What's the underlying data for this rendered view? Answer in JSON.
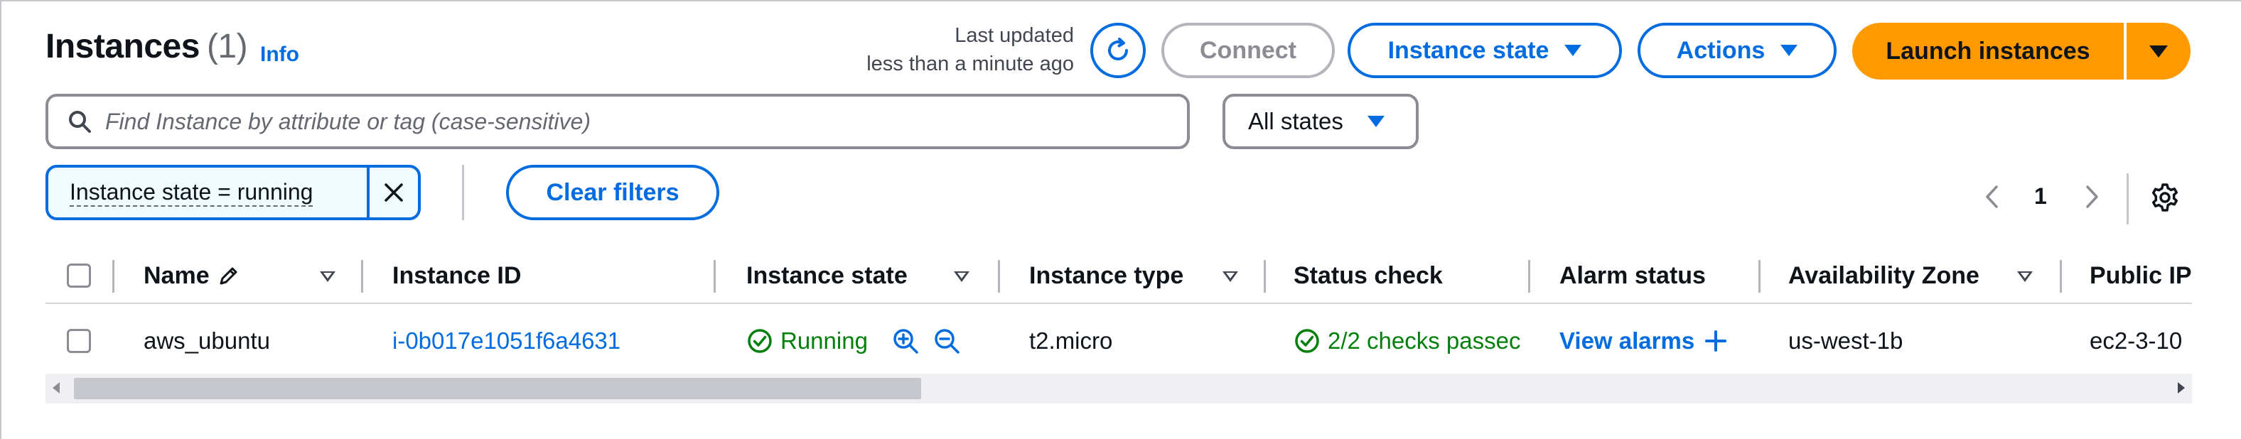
{
  "header": {
    "title": "Instances",
    "count": "(1)",
    "info_link": "Info",
    "last_updated_line1": "Last updated",
    "last_updated_line2": "less than a minute ago"
  },
  "toolbar": {
    "connect_label": "Connect",
    "instance_state_label": "Instance state",
    "actions_label": "Actions",
    "launch_label": "Launch instances"
  },
  "search": {
    "placeholder": "Find Instance by attribute or tag (case-sensitive)",
    "value": ""
  },
  "state_filter": {
    "selected": "All states"
  },
  "filter_tokens": [
    {
      "label": "Instance state = running"
    }
  ],
  "clear_filters_label": "Clear filters",
  "pagination": {
    "current_page": "1"
  },
  "table": {
    "columns": [
      "Name",
      "Instance ID",
      "Instance state",
      "Instance type",
      "Status check",
      "Alarm status",
      "Availability Zone",
      "Public IP"
    ],
    "rows": [
      {
        "name": "aws_ubuntu",
        "instance_id": "i-0b017e1051f6a4631",
        "instance_state": "Running",
        "instance_type": "t2.micro",
        "status_check": "2/2 checks passec",
        "alarm_status": "View alarms",
        "availability_zone": "us-west-1b",
        "public_ip": "ec2-3-10"
      }
    ]
  },
  "colors": {
    "link_blue": "#006ce0",
    "launch_orange": "#ff9900",
    "success_green": "#037f0c",
    "border_gray": "#8c8c94"
  },
  "icons": {
    "refresh": "refresh-icon",
    "search": "search-icon",
    "close": "close-icon",
    "settings": "gear-icon",
    "edit": "pencil-icon",
    "running": "check-circle-icon",
    "zoom_in": "zoom-in-icon",
    "zoom_out": "zoom-out-icon",
    "add": "plus-icon"
  }
}
